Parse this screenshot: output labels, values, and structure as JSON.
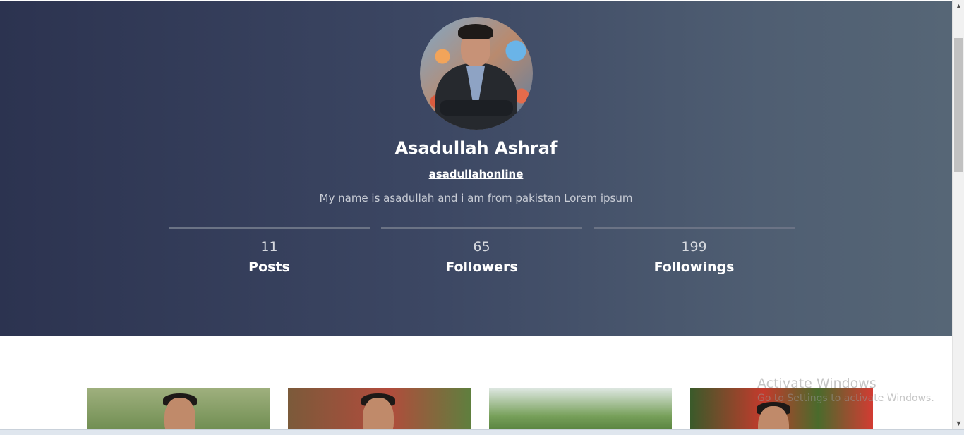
{
  "profile": {
    "name": "Asadullah Ashraf",
    "username": "asadullahonline",
    "bio": "My name is asadullah and i am from pakistan Lorem ipsum"
  },
  "stats": [
    {
      "value": "11",
      "label": "Posts"
    },
    {
      "value": "65",
      "label": "Followers"
    },
    {
      "value": "199",
      "label": "Followings"
    }
  ],
  "watermark": {
    "title": "Activate Windows",
    "subtitle": "Go to Settings to activate Windows."
  },
  "colors": {
    "hero_start": "#2c3350",
    "hero_end": "#566676"
  },
  "icons": {
    "scroll_up": "triangle-up",
    "scroll_down": "triangle-down"
  }
}
